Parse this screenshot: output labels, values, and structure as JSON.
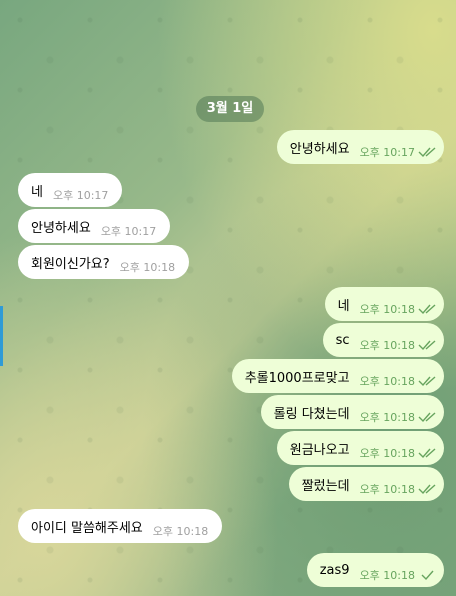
{
  "date_separator": "3월 1일",
  "messages": [
    {
      "direction": "out",
      "text": "안녕하세요",
      "time": "오후 10:17",
      "status": "read"
    },
    {
      "direction": "in",
      "text": "네",
      "time": "오후 10:17"
    },
    {
      "direction": "in",
      "text": "안녕하세요",
      "time": "오후 10:17"
    },
    {
      "direction": "in",
      "text": "회원이신가요?",
      "time": "오후 10:18"
    },
    {
      "direction": "out",
      "text": "네",
      "time": "오후 10:18",
      "status": "read"
    },
    {
      "direction": "out",
      "text": "sc",
      "time": "오후 10:18",
      "status": "read"
    },
    {
      "direction": "out",
      "text": "추롤1000프로맞고",
      "time": "오후 10:18",
      "status": "read"
    },
    {
      "direction": "out",
      "text": "롤링 다쳤는데",
      "time": "오후 10:18",
      "status": "read"
    },
    {
      "direction": "out",
      "text": "원금나오고",
      "time": "오후 10:18",
      "status": "read"
    },
    {
      "direction": "out",
      "text": "짤렀는데",
      "time": "오후 10:18",
      "status": "read"
    },
    {
      "direction": "in",
      "text": "아이디 말씀해주세요",
      "time": "오후 10:18"
    },
    {
      "direction": "out",
      "text": "zas9",
      "time": "오후 10:18",
      "status": "sent"
    }
  ],
  "colors": {
    "incoming_bubble": "#ffffff",
    "outgoing_bubble": "#eefed7",
    "outgoing_meta": "#67a45e",
    "incoming_meta": "#a0a0a0"
  }
}
